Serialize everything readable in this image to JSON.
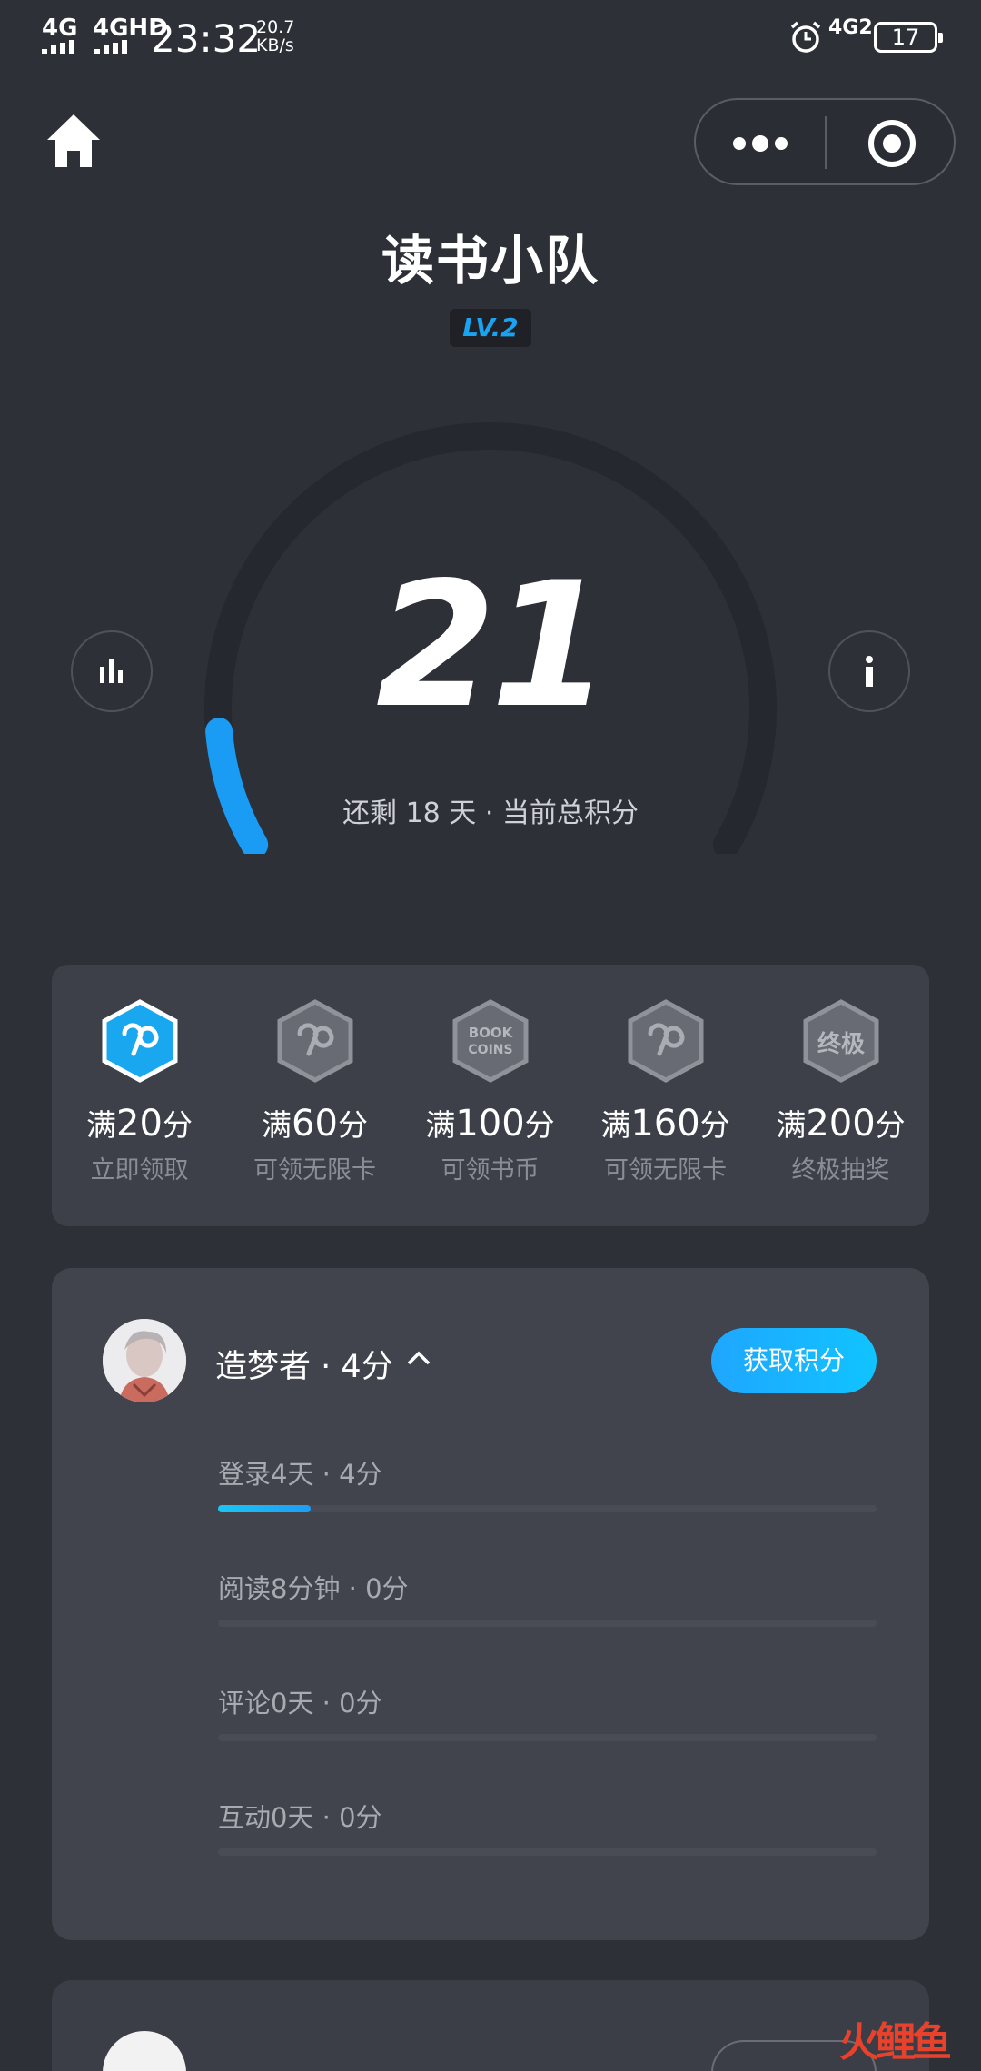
{
  "status_bar": {
    "signal1": "4G",
    "signal2": "4GHD",
    "time": "23:32",
    "speed_value": "20.7",
    "speed_unit": "KB/s",
    "network_right": "4G2",
    "battery": "17"
  },
  "header": {
    "title": "读书小队",
    "level": "LV.2"
  },
  "gauge": {
    "score": "21",
    "subtitle": "还剩 18 天 · 当前总积分",
    "progress_fraction": 0.105,
    "accent": "#1aa3f0"
  },
  "rewards": [
    {
      "prefix": "满",
      "points": "20",
      "suffix": "分",
      "label": "立即领取",
      "icon": "infinity-hex-icon",
      "active": true
    },
    {
      "prefix": "满",
      "points": "60",
      "suffix": "分",
      "label": "可领无限卡",
      "icon": "infinity-hex-icon",
      "active": false
    },
    {
      "prefix": "满",
      "points": "100",
      "suffix": "分",
      "label": "可领书币",
      "icon": "book-coins-hex-icon",
      "icon_text_1": "BOOK",
      "icon_text_2": "COINS",
      "active": false
    },
    {
      "prefix": "满",
      "points": "160",
      "suffix": "分",
      "label": "可领无限卡",
      "icon": "infinity-hex-icon",
      "active": false
    },
    {
      "prefix": "满",
      "points": "200",
      "suffix": "分",
      "label": "终极抽奖",
      "icon": "ultimate-hex-icon",
      "icon_text": "终极",
      "active": false
    }
  ],
  "member": {
    "name": "造梦者 · 4分",
    "get_points_button": "获取积分",
    "tasks": [
      {
        "label": "登录4天 · 4分",
        "progress": 0.14
      },
      {
        "label": "阅读8分钟 · 0分",
        "progress": 0
      },
      {
        "label": "评论0天 · 0分",
        "progress": 0
      },
      {
        "label": "互动0天 · 0分",
        "progress": 0
      }
    ]
  },
  "watermark": "火鲤鱼",
  "colors": {
    "background": "#2e3038",
    "card": "#41444d",
    "accent": "#1aa3f0"
  }
}
